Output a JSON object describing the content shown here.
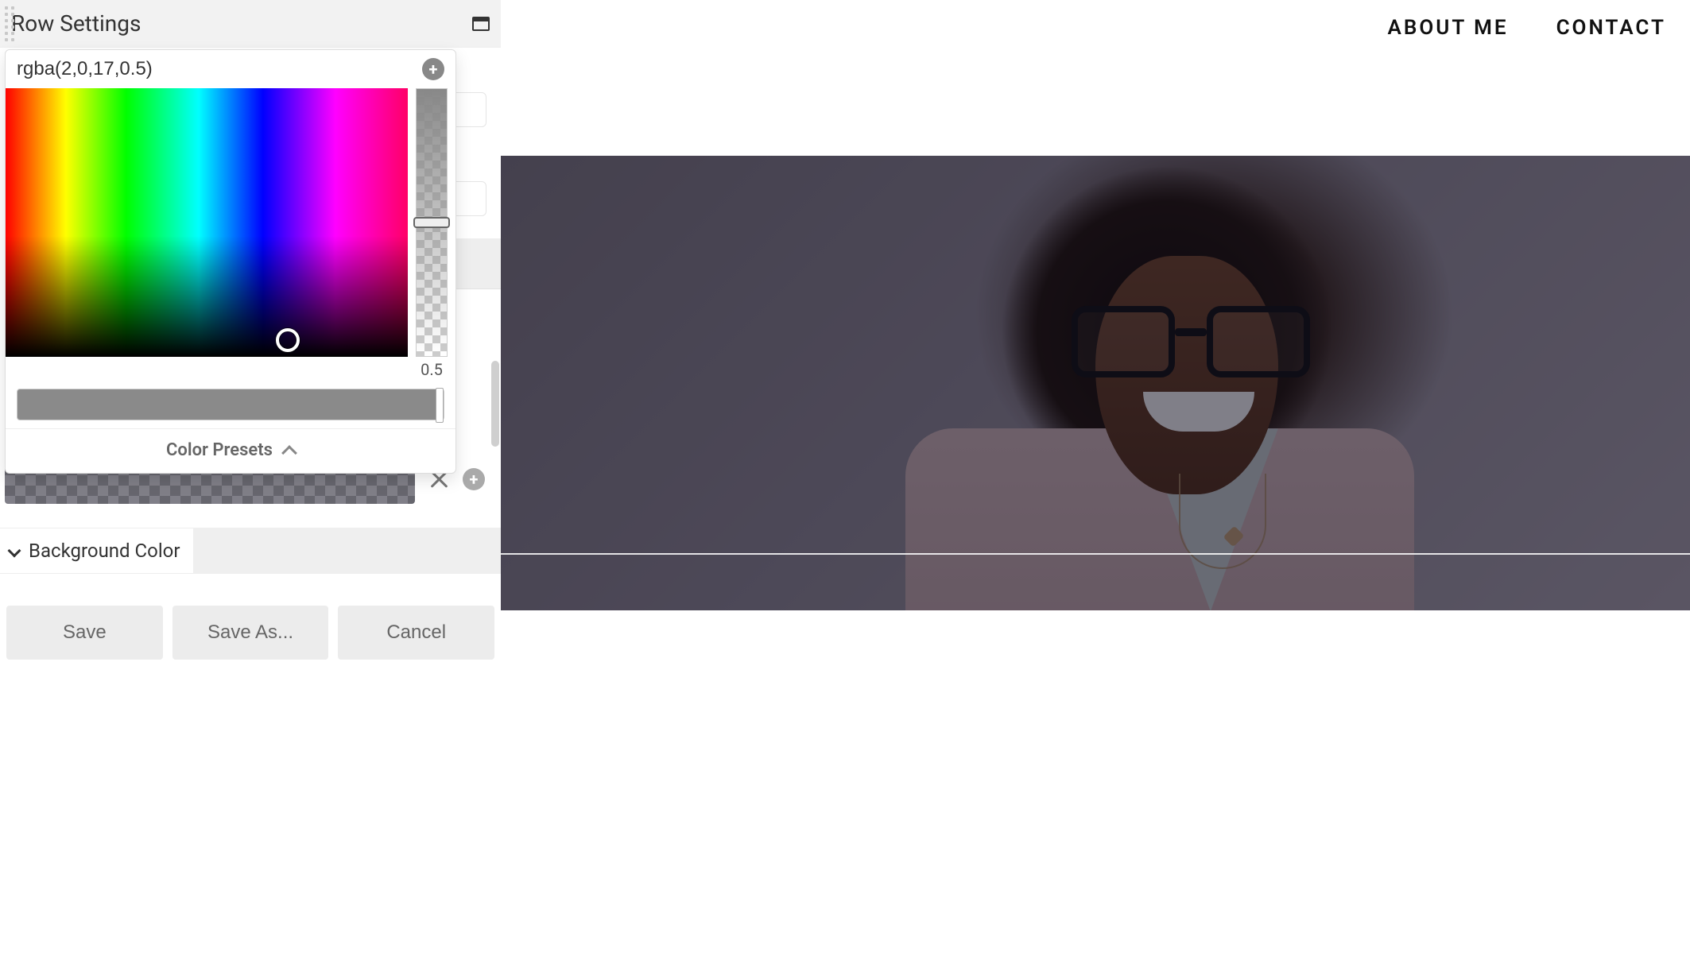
{
  "nav": {
    "about": "ABOUT ME",
    "contact": "CONTACT"
  },
  "panel": {
    "title": "Row Settings"
  },
  "color_picker": {
    "value": "rgba(2,0,17,0.5)",
    "alpha_label": "0.5",
    "presets_label": "Color Presets"
  },
  "section": {
    "background_color": "Background Color"
  },
  "footer": {
    "save": "Save",
    "save_as": "Save As...",
    "cancel": "Cancel"
  }
}
